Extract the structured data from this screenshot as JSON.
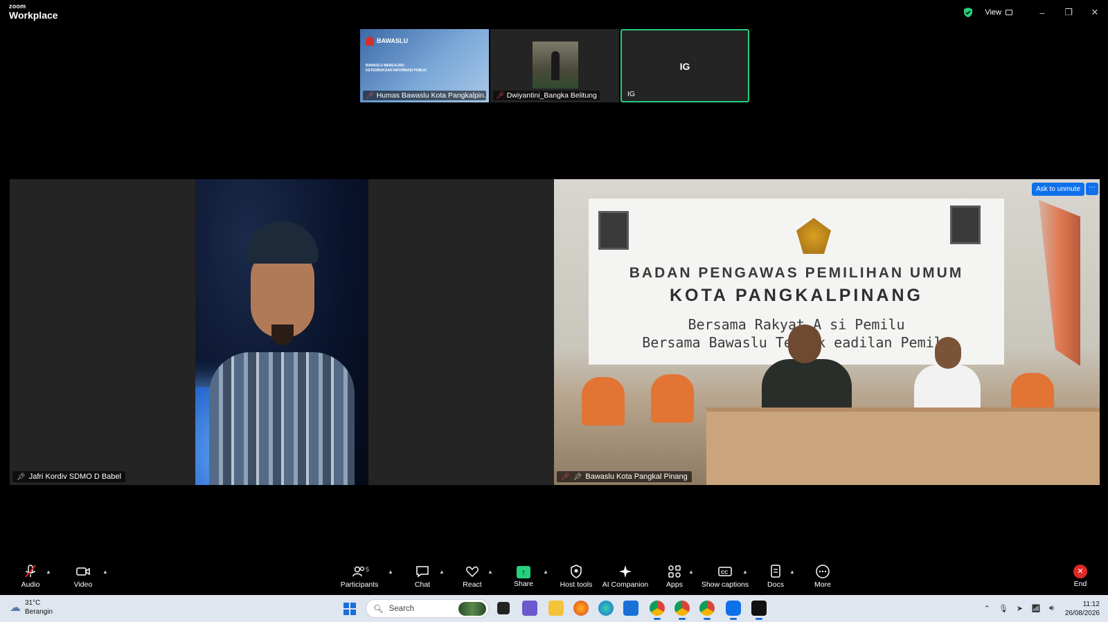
{
  "app": {
    "brand_small": "zoom",
    "brand_big": "Workplace"
  },
  "titlebar": {
    "view_label": "View",
    "minimize": "–",
    "restore": "❐",
    "close": "✕"
  },
  "thumbnails": [
    {
      "name": "Humas Bawaslu Kota Pangkalpin...",
      "muted": true,
      "type": "slide",
      "slide_logo": "BAWASLU",
      "slide_line1": "BAWASLU MENGAJAR:",
      "slide_line2": "KETERBUKAAN INFORMASI PUBLIK"
    },
    {
      "name": "Dwiyantini_Bangka Belitung",
      "muted": true,
      "type": "video"
    },
    {
      "name": "IG",
      "initials": "IG",
      "muted": false,
      "type": "avatar",
      "active": true
    }
  ],
  "gallery": {
    "left": {
      "name": "Jafri Kordiv SDMO D Babel",
      "pinned": true,
      "muted": false
    },
    "right": {
      "name": "Bawaslu Kota Pangkal Pinang",
      "pinned": true,
      "muted": true,
      "ask_unmute": "Ask to unmute",
      "more": "···",
      "banner_line1": "BADAN PENGAWAS PEMILIHAN UMUM",
      "banner_line2": "KOTA PANGKALPINANG",
      "banner_line3": "Bersama Rakyat A   si Pemilu",
      "banner_line4": "Bersama Bawaslu Tegakk   eadilan Pemilu"
    }
  },
  "toolbar": {
    "audio": "Audio",
    "video": "Video",
    "participants": "Participants",
    "participants_count": "5",
    "chat": "Chat",
    "react": "React",
    "share": "Share",
    "host_tools": "Host tools",
    "ai_companion": "AI Companion",
    "apps": "Apps",
    "captions": "Show captions",
    "docs": "Docs",
    "more": "More",
    "end": "End"
  },
  "taskbar": {
    "temperature": "31°C",
    "weather": "Berangin",
    "search_placeholder": "Search",
    "time": "11:12",
    "date": "26/08/2026"
  },
  "colors": {
    "zoom_green": "#26d07c",
    "zoom_blue": "#0e71eb",
    "end_red": "#e02828"
  }
}
